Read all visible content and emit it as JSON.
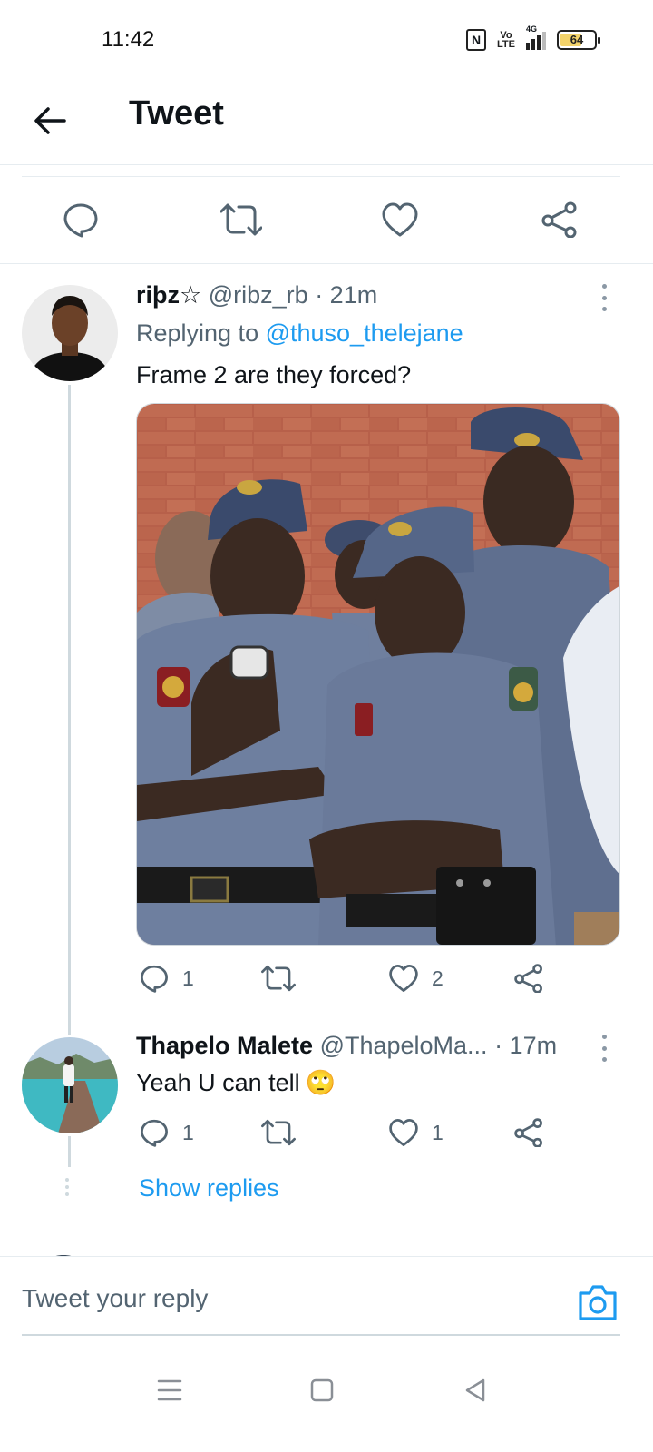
{
  "status_bar": {
    "time": "11:42",
    "nfc": "N",
    "volte_top": "Vo",
    "volte_bottom": "LTE",
    "network": "4G",
    "battery": "64",
    "battery_level": 0.64
  },
  "header": {
    "title": "Tweet",
    "back_icon": "arrow-left-icon"
  },
  "main_actions": [
    "reply-icon",
    "retweet-icon",
    "like-icon",
    "share-icon"
  ],
  "tweets": [
    {
      "name": "riþz☆",
      "handle": "@ribz_rb",
      "time": " · 21m",
      "replying_prefix": "Replying to ",
      "replying_handle": "@thuso_thelejane",
      "text": "Frame 2 are they forced?",
      "image_desc": "photo-of-police-officers",
      "replies": "1",
      "retweets": "",
      "likes": "2"
    },
    {
      "name": "Thapelo Malete",
      "handle": "@ThapeloMa...",
      "time": " · 17m",
      "text": "Yeah U can tell",
      "emoji": "🙄",
      "replies": "1",
      "retweets": "",
      "likes": "1"
    }
  ],
  "show_replies": "Show replies",
  "composer": {
    "placeholder": "Tweet your reply",
    "camera_icon": "camera-icon"
  },
  "colors": {
    "accent": "#1d9bf0",
    "text": "#0f1419",
    "muted": "#536471",
    "divider": "#e6ecf0"
  },
  "nav": [
    "menu-icon",
    "home-square-icon",
    "back-triangle-icon"
  ]
}
